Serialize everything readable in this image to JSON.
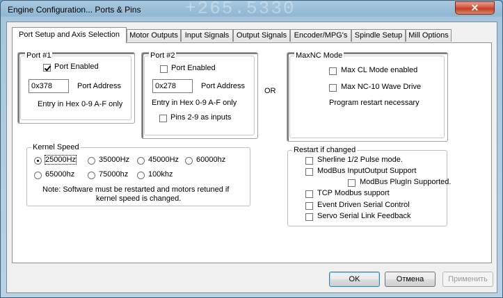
{
  "window": {
    "title": "Engine Configuration... Ports & Pins",
    "ghost_text": "+265.5330",
    "close_glyph": "✕"
  },
  "tabs": [
    {
      "label": "Port Setup and Axis Selection",
      "active": true
    },
    {
      "label": "Motor Outputs"
    },
    {
      "label": "Input Signals"
    },
    {
      "label": "Output Signals"
    },
    {
      "label": "Encoder/MPG's"
    },
    {
      "label": "Spindle Setup"
    },
    {
      "label": "Mill Options"
    }
  ],
  "port1": {
    "legend": "Port #1",
    "enabled_label": "Port Enabled",
    "enabled": true,
    "address_value": "0x378",
    "address_label": "Port Address",
    "hint": "Entry in Hex 0-9 A-F only"
  },
  "port2": {
    "legend": "Port #2",
    "enabled_label": "Port Enabled",
    "enabled": false,
    "address_value": "0x278",
    "address_label": "Port Address",
    "hint": "Entry in Hex 0-9 A-F only",
    "pins_label": "Pins 2-9 as inputs",
    "pins_checked": false
  },
  "or_label": "OR",
  "maxnc": {
    "legend": "MaxNC Mode",
    "cl_label": "Max CL Mode enabled",
    "cl_checked": false,
    "wave_label": "Max NC-10 Wave Drive",
    "wave_checked": false,
    "note": "Program restart necessary"
  },
  "kernel": {
    "legend": "Kernel Speed",
    "options": [
      "25000Hz",
      "35000Hz",
      "45000Hz",
      "60000hz",
      "65000hz",
      "75000hz",
      "100khz"
    ],
    "selected": "25000Hz",
    "note_line1": "Note: Software must be restarted and motors retuned if",
    "note_line2": "kernel speed is changed."
  },
  "restart": {
    "legend": "Restart if changed",
    "items": [
      {
        "label": "Sherline 1/2 Pulse mode.",
        "checked": false
      },
      {
        "label": "ModBus InputOutput Support",
        "checked": false
      },
      {
        "label": "ModBus PlugIn Supported.",
        "checked": false
      },
      {
        "label": "TCP Modbus support",
        "checked": false
      },
      {
        "label": "Event Driven Serial Control",
        "checked": false
      },
      {
        "label": "Servo Serial Link Feedback",
        "checked": false
      }
    ]
  },
  "buttons": {
    "ok": "OK",
    "cancel": "Отмена",
    "apply": "Применить"
  }
}
